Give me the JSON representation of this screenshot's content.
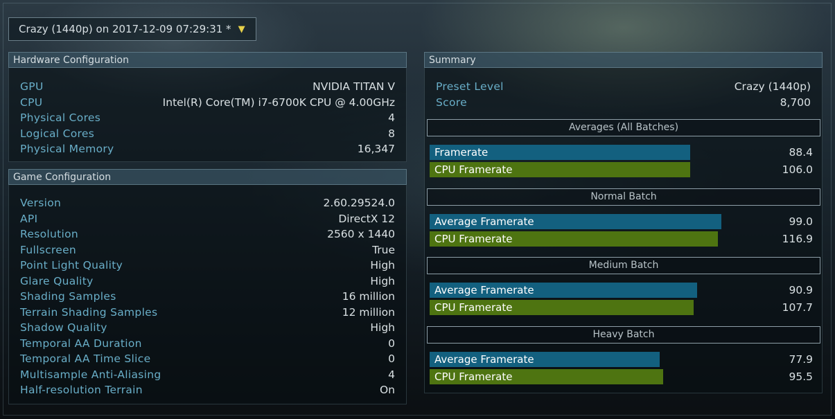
{
  "header": {
    "run_selector": "Crazy (1440p) on 2017-12-09 07:29:31 *"
  },
  "hardware": {
    "title": "Hardware Configuration",
    "rows": [
      {
        "label": "GPU",
        "value": "NVIDIA TITAN V"
      },
      {
        "label": "CPU",
        "value": "Intel(R) Core(TM) i7-6700K CPU @ 4.00GHz"
      },
      {
        "label": "Physical Cores",
        "value": "4"
      },
      {
        "label": "Logical Cores",
        "value": "8"
      },
      {
        "label": "Physical Memory",
        "value": "16,347"
      }
    ]
  },
  "game": {
    "title": "Game Configuration",
    "rows": [
      {
        "label": "Version",
        "value": "2.60.29524.0"
      },
      {
        "label": "API",
        "value": "DirectX 12"
      },
      {
        "label": "Resolution",
        "value": "2560 x 1440"
      },
      {
        "label": "Fullscreen",
        "value": "True"
      },
      {
        "label": "Point Light Quality",
        "value": "High"
      },
      {
        "label": "Glare Quality",
        "value": "High"
      },
      {
        "label": "Shading Samples",
        "value": "16 million"
      },
      {
        "label": "Terrain Shading Samples",
        "value": "12 million"
      },
      {
        "label": "Shadow Quality",
        "value": "High"
      },
      {
        "label": "Temporal AA Duration",
        "value": "0"
      },
      {
        "label": "Temporal AA Time Slice",
        "value": "0"
      },
      {
        "label": "Multisample Anti-Aliasing",
        "value": "4"
      },
      {
        "label": "Half-resolution Terrain",
        "value": "On"
      }
    ]
  },
  "summary": {
    "title": "Summary",
    "rows": [
      {
        "label": "Preset Level",
        "value": "Crazy (1440p)"
      },
      {
        "label": "Score",
        "value": "8,700"
      }
    ],
    "sections": [
      {
        "title": "Averages (All Batches)",
        "bars": [
          {
            "label": "Framerate",
            "value": "88.4",
            "fraction": 0.76,
            "color": "#13607f"
          },
          {
            "label": "CPU Framerate",
            "value": "106.0",
            "fraction": 0.76,
            "color": "#4e7411"
          }
        ]
      },
      {
        "title": "Normal Batch",
        "bars": [
          {
            "label": "Average Framerate",
            "value": "99.0",
            "fraction": 0.85,
            "color": "#13607f"
          },
          {
            "label": "CPU Framerate",
            "value": "116.9",
            "fraction": 0.84,
            "color": "#4e7411"
          }
        ]
      },
      {
        "title": "Medium Batch",
        "bars": [
          {
            "label": "Average Framerate",
            "value": "90.9",
            "fraction": 0.78,
            "color": "#13607f"
          },
          {
            "label": "CPU Framerate",
            "value": "107.7",
            "fraction": 0.77,
            "color": "#4e7411"
          }
        ]
      },
      {
        "title": "Heavy Batch",
        "bars": [
          {
            "label": "Average Framerate",
            "value": "77.9",
            "fraction": 0.67,
            "color": "#13607f"
          },
          {
            "label": "CPU Framerate",
            "value": "95.5",
            "fraction": 0.68,
            "color": "#4e7411"
          }
        ]
      }
    ]
  }
}
